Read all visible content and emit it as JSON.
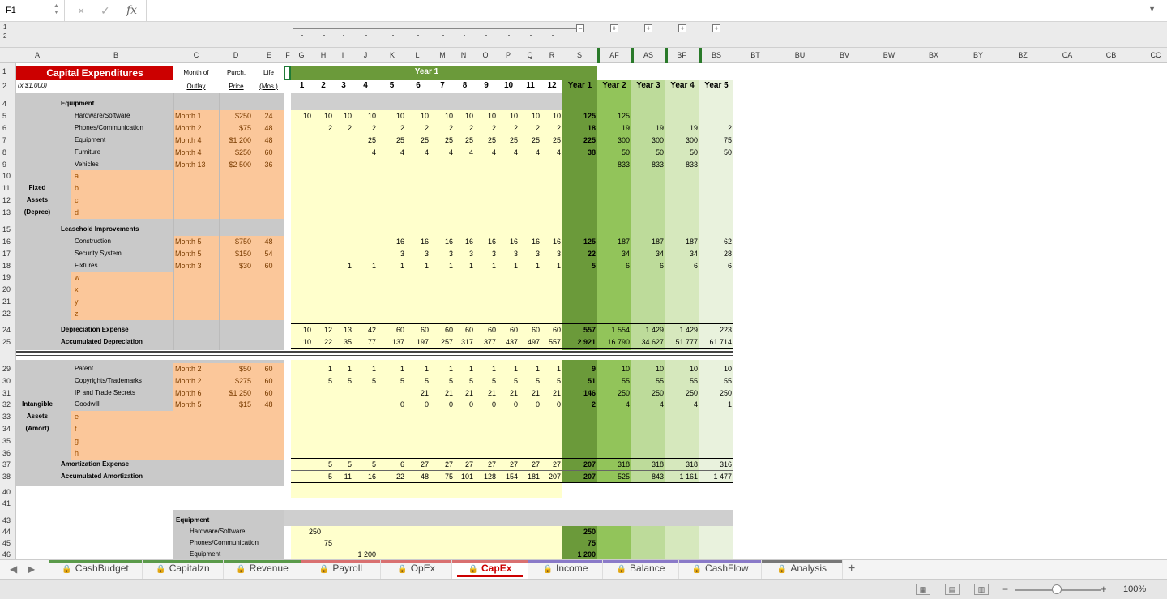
{
  "formula_bar": {
    "cell_ref": "F1",
    "cancel_icon": "×",
    "enter_icon": "✓",
    "fx_label": "fx",
    "formula": ""
  },
  "group_levels": [
    "1",
    "2"
  ],
  "column_headers": [
    {
      "label": "A",
      "c": 46
    },
    {
      "label": "B",
      "c": 143
    },
    {
      "label": "C",
      "c": 242
    },
    {
      "label": "D",
      "c": 291
    },
    {
      "label": "E",
      "c": 332
    },
    {
      "label": "F",
      "c": 355
    },
    {
      "label": "G",
      "c": 372
    },
    {
      "label": "H",
      "c": 399
    },
    {
      "label": "I",
      "c": 423
    },
    {
      "label": "J",
      "c": 451
    },
    {
      "label": "K",
      "c": 484
    },
    {
      "label": "L",
      "c": 515
    },
    {
      "label": "M",
      "c": 546
    },
    {
      "label": "N",
      "c": 572
    },
    {
      "label": "O",
      "c": 599
    },
    {
      "label": "P",
      "c": 627
    },
    {
      "label": "Q",
      "c": 654
    },
    {
      "label": "R",
      "c": 681
    },
    {
      "label": "S",
      "c": 715
    },
    {
      "label": "AF",
      "c": 758
    },
    {
      "label": "AS",
      "c": 800
    },
    {
      "label": "BF",
      "c": 841
    },
    {
      "label": "BS",
      "c": 884
    },
    {
      "label": "BT",
      "c": 932
    },
    {
      "label": "BU",
      "c": 987
    },
    {
      "label": "BV",
      "c": 1042
    },
    {
      "label": "BW",
      "c": 1097
    },
    {
      "label": "BX",
      "c": 1152
    },
    {
      "label": "BY",
      "c": 1207
    },
    {
      "label": "BZ",
      "c": 1262
    },
    {
      "label": "CA",
      "c": 1317
    },
    {
      "label": "CB",
      "c": 1371
    },
    {
      "label": "CC",
      "c": 1426
    }
  ],
  "row_numbers": [
    "1",
    "2",
    "4",
    "5",
    "6",
    "7",
    "8",
    "9",
    "10",
    "11",
    "12",
    "13",
    "15",
    "16",
    "17",
    "18",
    "19",
    "20",
    "21",
    "22",
    "24",
    "25",
    "29",
    "30",
    "31",
    "32",
    "33",
    "34",
    "35",
    "36",
    "37",
    "38",
    "40",
    "41",
    "43",
    "44",
    "45",
    "46"
  ],
  "header": {
    "title": "Capital Expenditures",
    "units": "(x $1,000)",
    "col_c": [
      "Month of",
      "Outlay"
    ],
    "col_d": [
      "Purch.",
      "Price"
    ],
    "col_e": [
      "Life",
      "(Mos.)"
    ],
    "year1_banner": "Year 1",
    "months": [
      "1",
      "2",
      "3",
      "4",
      "5",
      "6",
      "7",
      "8",
      "9",
      "10",
      "11",
      "12"
    ],
    "years": [
      "Year 1",
      "Year 2",
      "Year 3",
      "Year 4",
      "Year 5"
    ]
  },
  "fixed": {
    "side_label": [
      "Fixed",
      "Assets",
      "(Deprec)"
    ],
    "equip_header": "Equipment",
    "equip": [
      {
        "name": "Hardware/Software",
        "month": "Month 1",
        "price": "$250",
        "life": "24",
        "m": [
          "10",
          "10",
          "10",
          "10",
          "10",
          "10",
          "10",
          "10",
          "10",
          "10",
          "10",
          "10"
        ],
        "y": [
          "125",
          "125",
          "",
          "",
          ""
        ]
      },
      {
        "name": "Phones/Communication",
        "month": "Month 2",
        "price": "$75",
        "life": "48",
        "m": [
          "",
          "2",
          "2",
          "2",
          "2",
          "2",
          "2",
          "2",
          "2",
          "2",
          "2",
          "2"
        ],
        "y": [
          "18",
          "19",
          "19",
          "19",
          "2"
        ]
      },
      {
        "name": "Equipment",
        "month": "Month 4",
        "price": "$1 200",
        "life": "48",
        "m": [
          "",
          "",
          "",
          "25",
          "25",
          "25",
          "25",
          "25",
          "25",
          "25",
          "25",
          "25"
        ],
        "y": [
          "225",
          "300",
          "300",
          "300",
          "75"
        ]
      },
      {
        "name": "Furniture",
        "month": "Month 4",
        "price": "$250",
        "life": "60",
        "m": [
          "",
          "",
          "",
          "4",
          "4",
          "4",
          "4",
          "4",
          "4",
          "4",
          "4",
          "4"
        ],
        "y": [
          "38",
          "50",
          "50",
          "50",
          "50"
        ]
      },
      {
        "name": "Vehicles",
        "month": "Month 13",
        "price": "$2 500",
        "life": "36",
        "m": [
          "",
          "",
          "",
          "",
          "",
          "",
          "",
          "",
          "",
          "",
          "",
          ""
        ],
        "y": [
          "",
          "833",
          "833",
          "833",
          ""
        ]
      }
    ],
    "equip_blanks": [
      "a",
      "b",
      "c",
      "d"
    ],
    "lh_header": "Leasehold Improvements",
    "lh": [
      {
        "name": "Construction",
        "month": "Month 5",
        "price": "$750",
        "life": "48",
        "m": [
          "",
          "",
          "",
          "",
          "16",
          "16",
          "16",
          "16",
          "16",
          "16",
          "16",
          "16"
        ],
        "y": [
          "125",
          "187",
          "187",
          "187",
          "62"
        ]
      },
      {
        "name": "Security System",
        "month": "Month 5",
        "price": "$150",
        "life": "54",
        "m": [
          "",
          "",
          "",
          "",
          "3",
          "3",
          "3",
          "3",
          "3",
          "3",
          "3",
          "3"
        ],
        "y": [
          "22",
          "34",
          "34",
          "34",
          "28"
        ]
      },
      {
        "name": "Fixtures",
        "month": "Month 3",
        "price": "$30",
        "life": "60",
        "m": [
          "",
          "",
          "1",
          "1",
          "1",
          "1",
          "1",
          "1",
          "1",
          "1",
          "1",
          "1"
        ],
        "y": [
          "5",
          "6",
          "6",
          "6",
          "6"
        ]
      }
    ],
    "lh_blanks": [
      "w",
      "x",
      "y",
      "z"
    ],
    "dep_label": "Depreciation Expense",
    "dep": {
      "m": [
        "10",
        "12",
        "13",
        "42",
        "60",
        "60",
        "60",
        "60",
        "60",
        "60",
        "60",
        "60"
      ],
      "y": [
        "557",
        "1 554",
        "1 429",
        "1 429",
        "223"
      ]
    },
    "acc_label": "Accumulated Depreciation",
    "acc": {
      "m": [
        "10",
        "22",
        "35",
        "77",
        "137",
        "197",
        "257",
        "317",
        "377",
        "437",
        "497",
        "557"
      ],
      "y": [
        "2 921",
        "16 790",
        "34 627",
        "51 777",
        "61 714"
      ]
    }
  },
  "intangible": {
    "side_label": [
      "Intangible",
      "Assets",
      "(Amort)"
    ],
    "items": [
      {
        "name": "Patent",
        "month": "Month 2",
        "price": "$50",
        "life": "60",
        "m": [
          "",
          "1",
          "1",
          "1",
          "1",
          "1",
          "1",
          "1",
          "1",
          "1",
          "1",
          "1"
        ],
        "y": [
          "9",
          "10",
          "10",
          "10",
          "10"
        ]
      },
      {
        "name": "Copyrights/Trademarks",
        "month": "Month 2",
        "price": "$275",
        "life": "60",
        "m": [
          "",
          "5",
          "5",
          "5",
          "5",
          "5",
          "5",
          "5",
          "5",
          "5",
          "5",
          "5"
        ],
        "y": [
          "51",
          "55",
          "55",
          "55",
          "55"
        ]
      },
      {
        "name": "IP and Trade Secrets",
        "month": "Month 6",
        "price": "$1 250",
        "life": "60",
        "m": [
          "",
          "",
          "",
          "",
          "",
          "21",
          "21",
          "21",
          "21",
          "21",
          "21",
          "21"
        ],
        "y": [
          "146",
          "250",
          "250",
          "250",
          "250"
        ]
      },
      {
        "name": "Goodwill",
        "month": "Month 5",
        "price": "$15",
        "life": "48",
        "m": [
          "",
          "",
          "",
          "",
          "0",
          "0",
          "0",
          "0",
          "0",
          "0",
          "0",
          "0"
        ],
        "y": [
          "2",
          "4",
          "4",
          "4",
          "1"
        ]
      }
    ],
    "blanks": [
      "e",
      "f",
      "g",
      "h"
    ],
    "amort_label": "Amortization Expense",
    "amort": {
      "m": [
        "",
        "5",
        "5",
        "5",
        "6",
        "27",
        "27",
        "27",
        "27",
        "27",
        "27",
        "27"
      ],
      "y": [
        "207",
        "318",
        "318",
        "318",
        "316"
      ]
    },
    "acc_label": "Accumulated Amortization",
    "acc": {
      "m": [
        "",
        "5",
        "11",
        "16",
        "22",
        "48",
        "75",
        "101",
        "128",
        "154",
        "181",
        "207"
      ],
      "y": [
        "207",
        "525",
        "843",
        "1 161",
        "1 477"
      ]
    }
  },
  "outlay": {
    "header": "Equipment",
    "items": [
      {
        "name": "Hardware/Software",
        "m": [
          "250",
          "",
          "",
          "",
          "",
          "",
          "",
          "",
          "",
          "",
          "",
          ""
        ],
        "y1": "250"
      },
      {
        "name": "Phones/Communication",
        "m": [
          "",
          "75",
          "",
          "",
          "",
          "",
          "",
          "",
          "",
          "",
          "",
          ""
        ],
        "y1": "75"
      },
      {
        "name": "Equipment",
        "m": [
          "",
          "",
          "",
          "1 200",
          "",
          "",
          "",
          "",
          "",
          "",
          "",
          ""
        ],
        "y1": "1 200"
      }
    ]
  },
  "sheet_tabs": [
    {
      "name": "CashBudget",
      "color": "#5a9a4a"
    },
    {
      "name": "Capitalzn",
      "color": "#5a9a4a"
    },
    {
      "name": "Revenue",
      "color": "#5a9a4a"
    },
    {
      "name": "Payroll",
      "color": "#d97070"
    },
    {
      "name": "OpEx",
      "color": "#d97070"
    },
    {
      "name": "CapEx",
      "color": "#d97070",
      "active": true
    },
    {
      "name": "Income",
      "color": "#8a7ac8"
    },
    {
      "name": "Balance",
      "color": "#8a7ac8"
    },
    {
      "name": "CashFlow",
      "color": "#8a7ac8"
    },
    {
      "name": "Analysis",
      "color": "#777777"
    }
  ],
  "status": {
    "zoom": "100%",
    "minus": "−",
    "plus": "+"
  },
  "colors": {
    "title_red": "#cc0000",
    "label_gray": "#c9c9c9",
    "input_orange": "#fbc79a",
    "cream": "#ffffcc",
    "y1": "#6b9a3a",
    "y2": "#92c45a",
    "y3": "#bddb9a",
    "y4": "#d6e8bd",
    "y5": "#e9f2dd"
  }
}
